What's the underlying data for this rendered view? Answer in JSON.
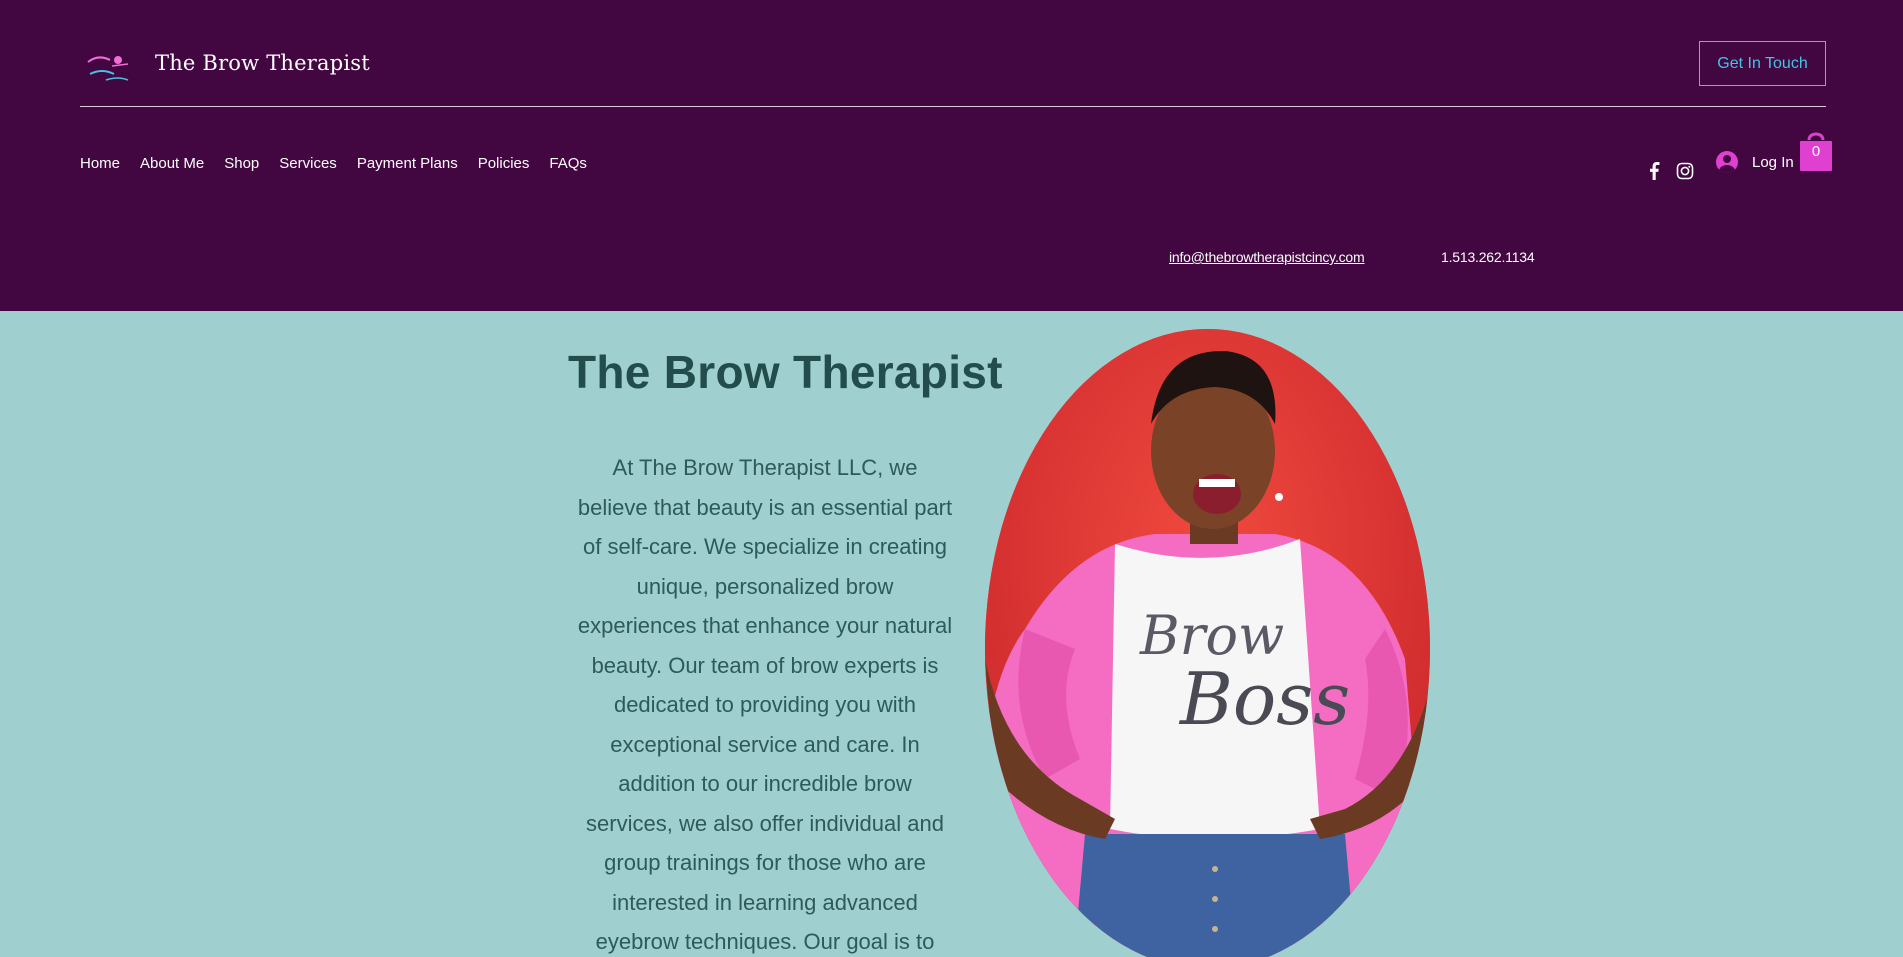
{
  "header": {
    "site_title": "The Brow Therapist",
    "logo_alt": "Brow Therapist",
    "cta_label": "Get In Touch",
    "nav": [
      "Home",
      "About Me",
      "Shop",
      "Services",
      "Payment Plans",
      "Policies",
      "FAQs"
    ],
    "login_label": "Log In",
    "cart_count": "0",
    "email": "info@thebrowtherapistcincy.com",
    "phone": "1.513.262.1134",
    "icons": [
      "facebook-icon",
      "instagram-icon",
      "avatar-icon",
      "shopping-bag-icon"
    ]
  },
  "hero": {
    "title": "The Brow Therapist",
    "body": "At The Brow Therapist LLC, we believe that beauty is an essential part of self-care. We specialize in creating unique, personalized brow experiences that enhance your natural beauty. Our team of brow experts is dedicated to providing you with exceptional service and care. In addition to our incredible brow services, we also offer individual and group trainings for those who are interested in learning advanced eyebrow techniques. Our goal is to",
    "shirt_text_1": "Brow",
    "shirt_text_2": "Boss"
  },
  "colors": {
    "header_bg": "#420640",
    "hero_bg": "#9fcfcf",
    "accent_cyan": "#3fc6e4",
    "accent_pink": "#e040cf",
    "title_color": "#234d4d"
  }
}
